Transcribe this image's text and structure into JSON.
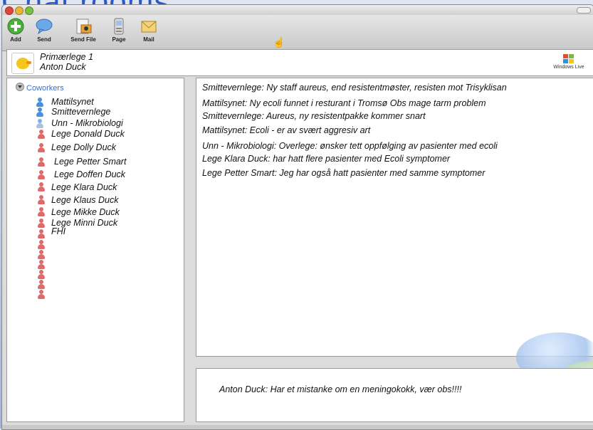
{
  "slide_title": "Chat rooms",
  "toolbar": {
    "items": [
      {
        "label": "Add"
      },
      {
        "label": "Send"
      },
      {
        "label": "Send File"
      },
      {
        "label": "Page"
      },
      {
        "label": "Mail"
      }
    ]
  },
  "header": {
    "group_name": "Primærlege 1",
    "user_name": "Anton Duck",
    "brand": "Windows Live"
  },
  "sidebar": {
    "section_label": "Coworkers",
    "contacts": [
      {
        "name": "Mattilsynet",
        "status": "online"
      },
      {
        "name": "Smittevernlege",
        "status": "online"
      },
      {
        "name": "Unn - Mikrobiologi",
        "status": "away"
      },
      {
        "name": "Lege Donald Duck",
        "status": "offline"
      },
      {
        "name": "Lege Dolly Duck",
        "status": "offline"
      },
      {
        "name": "Lege Petter Smart",
        "status": "offline"
      },
      {
        "name": "Lege Doffen Duck",
        "status": "offline"
      },
      {
        "name": "Lege Klara Duck",
        "status": "offline"
      },
      {
        "name": "Lege Klaus Duck",
        "status": "offline"
      },
      {
        "name": "Lege Mikke Duck",
        "status": "offline"
      },
      {
        "name": "Lege Minni Duck",
        "status": "offline"
      },
      {
        "name": "FHI",
        "status": "offline"
      }
    ]
  },
  "chat": {
    "messages": [
      "Smittevernlege: Ny staff aureus, end resistentmøster, resisten mot Trisyklisan",
      "Mattilsynet: Ny ecoli funnet i resturant i Tromsø Obs mage tarm problem",
      "Smittevernlege: Aureus, ny resistentpakke kommer snart",
      "Mattilsynet: Ecoli - er  av svært aggresiv art",
      "Unn - Mikrobiologi: Overlege: ønsker tett oppfølging av pasienter med ecoli",
      "Lege Klara Duck: har hatt flere pasienter med Ecoli symptomer",
      "Lege Petter Smart: Jeg har også hatt pasienter med samme symptomer"
    ]
  },
  "compose": {
    "text": "Anton Duck: Har et mistanke om en meningokokk, vær obs!!!!"
  },
  "colors": {
    "accent": "#3a6fd1",
    "online": "#4b8fe0",
    "offline": "#e06a6a"
  }
}
